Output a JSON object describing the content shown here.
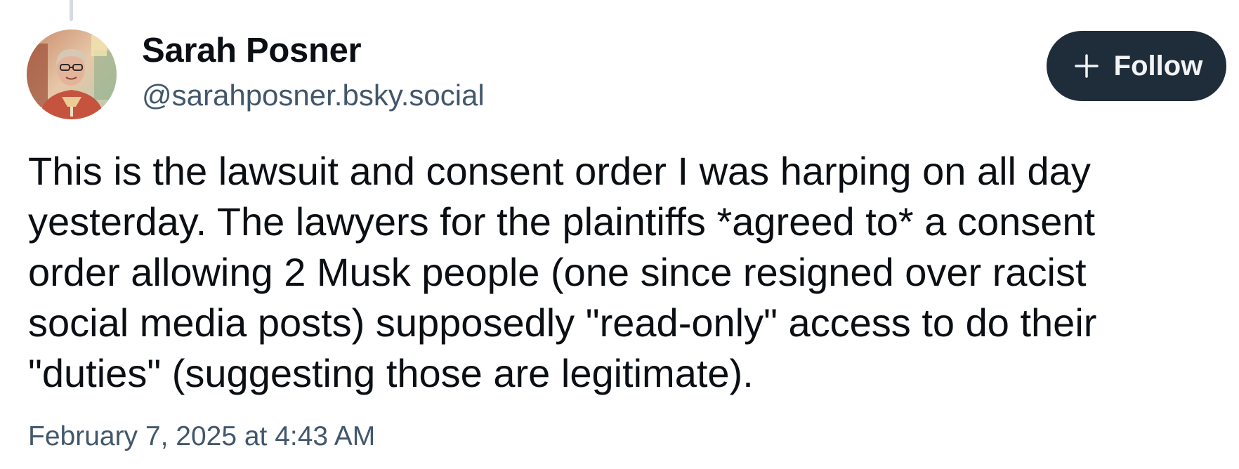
{
  "author": {
    "display_name": "Sarah Posner",
    "handle": "@sarahposner.bsky.social",
    "avatar_icon": "profile-photo"
  },
  "follow_button": {
    "label": "Follow",
    "icon": "plus-icon",
    "background": "#1f2d3a"
  },
  "post": {
    "text_lines": [
      "This is the lawsuit and consent order I was harping on all day",
      "yesterday. The lawyers for the plaintiffs *agreed to* a consent",
      "order allowing 2 Musk people (one since resigned over racist",
      "social media posts) supposedly \"read-only\" access to do their",
      "\"duties\" (suggesting those are legitimate)."
    ],
    "timestamp": "February 7, 2025 at 4:43 AM"
  },
  "colors": {
    "text_primary": "#0b0f14",
    "text_secondary": "#42576c",
    "thread_line": "#d4dbe2"
  }
}
